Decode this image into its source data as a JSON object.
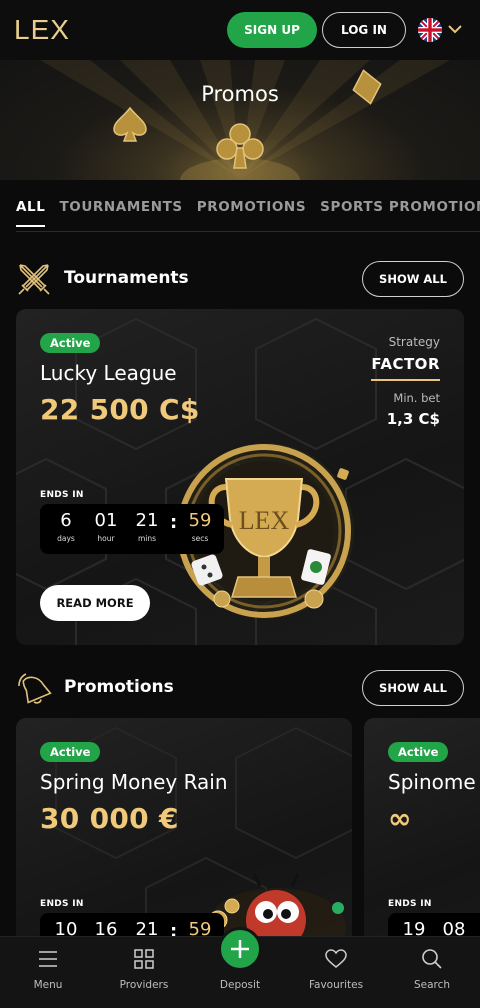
{
  "header": {
    "logo": "LEX",
    "signup_label": "SIGN UP",
    "login_label": "LOG IN",
    "language": "en-GB flag"
  },
  "banner": {
    "title": "Promos"
  },
  "tabs": [
    {
      "label": "ALL",
      "active": true
    },
    {
      "label": "TOURNAMENTS",
      "active": false
    },
    {
      "label": "PROMOTIONS",
      "active": false
    },
    {
      "label": "SPORTS PROMOTIONS",
      "active": false
    }
  ],
  "tournaments": {
    "section_title": "Tournaments",
    "section_icon": "crossed-swords-icon",
    "show_all_label": "SHOW ALL",
    "card": {
      "badge": "Active",
      "title": "Lucky League",
      "amount": "22 500 C$",
      "strategy_label": "Strategy",
      "strategy_value": "FACTOR",
      "min_bet_label": "Min. bet",
      "min_bet_value": "1,3 C$",
      "ends_in_label": "ENDS IN",
      "timer": {
        "days": "6",
        "days_label": "days",
        "hours": "01",
        "hours_label": "hour",
        "mins": "21",
        "mins_label": "mins",
        "secs": "59",
        "secs_label": "secs"
      },
      "read_more_label": "READ MORE",
      "art": "gold-trophy-LEX"
    }
  },
  "promotions": {
    "section_title": "Promotions",
    "section_icon": "bell-icon",
    "show_all_label": "SHOW ALL",
    "cards": [
      {
        "badge": "Active",
        "title": "Spring Money Rain",
        "amount": "30 000 €",
        "ends_in_label": "ENDS IN",
        "timer": {
          "days": "10",
          "hours": "16",
          "mins": "21",
          "secs": "59"
        }
      },
      {
        "badge": "Active",
        "title": "Spinome",
        "amount": "∞",
        "ends_in_label": "ENDS IN",
        "timer": {
          "days": "19",
          "hours": "08"
        }
      }
    ]
  },
  "bottom_nav": [
    {
      "label": "Menu",
      "icon": "menu-icon"
    },
    {
      "label": "Providers",
      "icon": "grid-icon"
    },
    {
      "label": "Deposit",
      "icon": "plus-icon"
    },
    {
      "label": "Favourites",
      "icon": "heart-icon"
    },
    {
      "label": "Search",
      "icon": "search-icon"
    }
  ],
  "colors": {
    "accent_green": "#21a548",
    "gold": "#f0c97a",
    "background": "#0b0b0b",
    "card": "#1b1b1b"
  }
}
